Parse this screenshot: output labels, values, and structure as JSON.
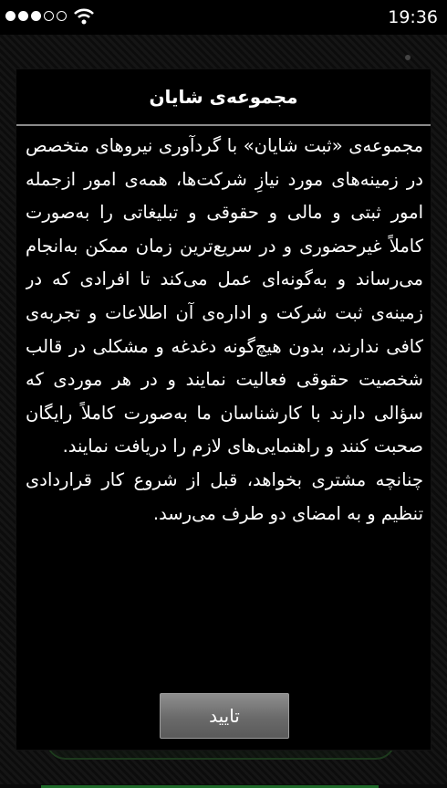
{
  "status_bar": {
    "time": "19:36",
    "signal_icon": "signal-dots-icon",
    "wifi_icon": "wifi-icon"
  },
  "dialog": {
    "title": "مجموعه‌ی شایان",
    "paragraphs": [
      "مجموعه‌ی «ثبت شایان» با گردآوری نیروهای متخصص در زمینه‌های مورد نیازِ شرکت‌ها، همه‌ی امور ازجمله امور ثبتی و مالی و حقوقی و تبلیغاتی را به‌صورت کاملاً غیرحضوری و در سریع‌ترین زمان ممکن به‌انجام می‌رساند و به‌گونه‌ای عمل می‌کند تا افرادی که در زمینه‌ی ثبت شرکت و اداره‌ی آن اطلاعات و تجربه‌ی کافی ندارند، بدون هیچ‌گونه دغدغه و مشکلی در قالب شخصیت حقوقی فعالیت نمایند و در هر موردی که سؤالی دارند با کارشناسان ما به‌صورت کاملاً رایگان صحبت کنند و راهنمایی‌های لازم را دریافت نمایند.",
      "چنانچه مشتری بخواهد، قبل از شروع کار قراردادی تنظیم و به امضای دو طرف می‌رسد."
    ],
    "confirm_label": "تایید"
  },
  "colors": {
    "dialog_bg": "#000000",
    "divider": "#8a8a8a",
    "button": "#7a7a7a",
    "accent_green": "#1f6b2a"
  }
}
